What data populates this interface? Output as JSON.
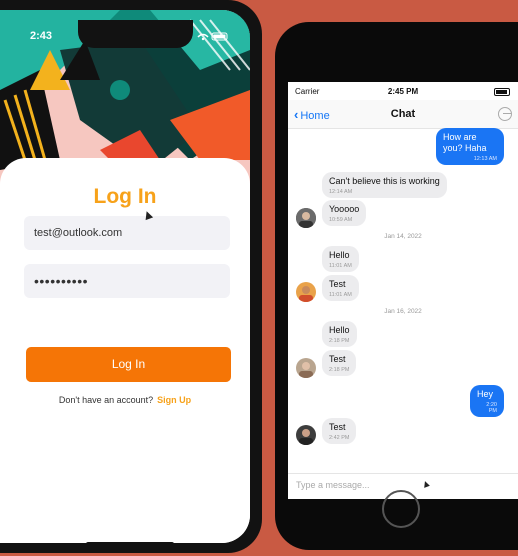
{
  "login": {
    "status_time": "2:43",
    "title": "Log In",
    "email_value": "test@outlook.com",
    "password_value": "••••••••••",
    "login_button": "Log In",
    "signup_prompt": "Don't have an account?",
    "signup_link": "Sign Up"
  },
  "chat": {
    "status": {
      "carrier": "Carrier",
      "time": "2:45 PM"
    },
    "nav": {
      "back_label": "Home",
      "title": "Chat"
    },
    "messages": [
      {
        "text": "How are you? Haha",
        "time": "12:13 AM"
      },
      {
        "text": "Can't believe this is working",
        "time": "12:14 AM"
      },
      {
        "text": "Yooooo",
        "time": "10:59 AM"
      },
      {
        "text": "Hello",
        "time": "11:01 AM"
      },
      {
        "text": "Test",
        "time": "11:01 AM"
      },
      {
        "text": "Hello",
        "time": "2:18 PM"
      },
      {
        "text": "Test",
        "time": "2:18 PM"
      },
      {
        "text": "Hey",
        "time": "2:20 PM"
      },
      {
        "text": "Test",
        "time": "2:42 PM"
      }
    ],
    "date_separators": [
      "Jan 14, 2022",
      "Jan 16, 2022"
    ],
    "input_placeholder": "Type a message..."
  },
  "colors": {
    "background": "#c95a43",
    "accent_orange": "#f57506",
    "title_orange": "#f7a21a",
    "ios_blue": "#1a75f4"
  }
}
